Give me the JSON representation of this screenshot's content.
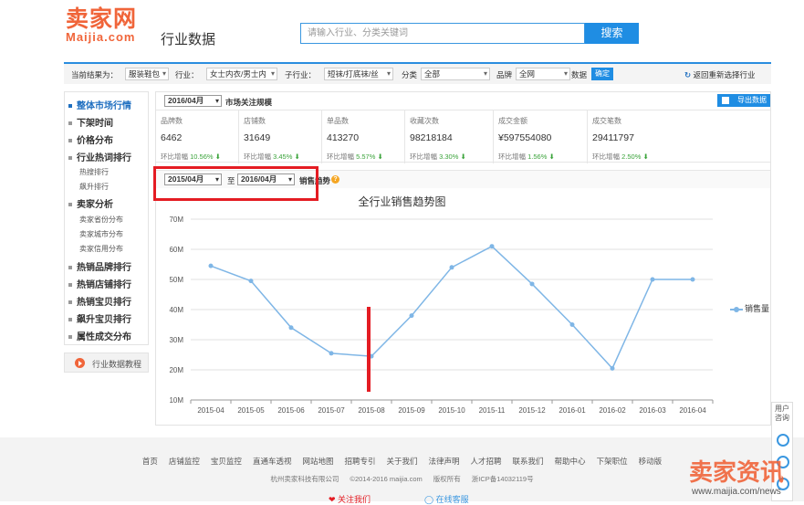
{
  "header": {
    "logo_cn": "卖家网",
    "logo_en": "Maijia.com",
    "section_title": "行业数据",
    "search_placeholder": "请输入行业、分类关键词",
    "search_button": "搜索"
  },
  "filter_bar": {
    "current_label": "当前结果为：",
    "fields": [
      {
        "label": "",
        "value": "服装鞋包"
      },
      {
        "label": "行业：",
        "value": "女士内衣/男士内"
      },
      {
        "label": "子行业：",
        "value": "短袜/打底袜/丝"
      },
      {
        "label": "分类",
        "value": "全部"
      },
      {
        "label": "品牌",
        "value": "全网"
      }
    ],
    "data_label": "数据",
    "confirm_button": "确定",
    "reselect_link": "返回重新选择行业"
  },
  "sidebar": {
    "items": [
      {
        "label": "整体市场行情",
        "active": true,
        "subs": []
      },
      {
        "label": "下架时间",
        "active": false,
        "subs": []
      },
      {
        "label": "价格分布",
        "active": false,
        "subs": []
      },
      {
        "label": "行业热词排行",
        "active": false,
        "subs": [
          "热搜排行",
          "飙升排行"
        ]
      },
      {
        "label": "卖家分析",
        "active": false,
        "subs": [
          "卖家省份分布",
          "卖家城市分布",
          "卖家信用分布"
        ]
      },
      {
        "label": "热销品牌排行",
        "active": false,
        "subs": []
      },
      {
        "label": "热销店铺排行",
        "active": false,
        "subs": []
      },
      {
        "label": "热销宝贝排行",
        "active": false,
        "subs": []
      },
      {
        "label": "飙升宝贝排行",
        "active": false,
        "subs": []
      },
      {
        "label": "属性成交分布",
        "active": false,
        "subs": []
      }
    ],
    "tutorial": "行业数据教程"
  },
  "overview": {
    "month": "2016/04月",
    "title": "市场关注规模",
    "export_button": "导出数据",
    "stats": [
      {
        "label": "品牌数",
        "value": "6462",
        "change_label": "环比增幅",
        "change": "10.56%"
      },
      {
        "label": "店铺数",
        "value": "31649",
        "change_label": "环比增幅",
        "change": "3.45%"
      },
      {
        "label": "单品数",
        "value": "413270",
        "change_label": "环比增幅",
        "change": "5.57%"
      },
      {
        "label": "收藏次数",
        "value": "98218184",
        "change_label": "环比增幅",
        "change": "3.30%"
      },
      {
        "label": "成交金额",
        "value": "¥597554080",
        "change_label": "环比增幅",
        "change": "1.56%"
      },
      {
        "label": "成交笔数",
        "value": "29411797",
        "change_label": "环比增幅",
        "change": "2.50%"
      }
    ]
  },
  "trend_controls": {
    "start_month": "2015/04月",
    "to": "至",
    "end_month": "2016/04月",
    "metric": "销售趋势",
    "help": "?"
  },
  "chart_data": {
    "type": "line",
    "title": "全行业销售趋势图",
    "x": [
      "2015-04",
      "2015-05",
      "2015-06",
      "2015-07",
      "2015-08",
      "2015-09",
      "2015-10",
      "2015-11",
      "2015-12",
      "2016-01",
      "2016-02",
      "2016-03",
      "2016-04"
    ],
    "series": [
      {
        "name": "销售量",
        "values": [
          54.5,
          49.5,
          34.0,
          25.5,
          24.5,
          38.0,
          54.0,
          61.0,
          48.5,
          35.0,
          20.5,
          50.0,
          50.0
        ]
      }
    ],
    "y_ticks": [
      "10M",
      "20M",
      "30M",
      "40M",
      "50M",
      "60M",
      "70M"
    ],
    "ylim": [
      10,
      70
    ],
    "y_unit": "M",
    "grid": true,
    "legend_position": "right",
    "color": "#7fb6e6"
  },
  "footer": {
    "nav": [
      "首页",
      "店铺监控",
      "宝贝监控",
      "直通车透视",
      "网站地图",
      "招聘专引",
      "关于我们",
      "法律声明",
      "人才招聘",
      "联系我们",
      "帮助中心",
      "下架职位",
      "移动版"
    ],
    "copyright": [
      "杭州卖家科技有限公司",
      "©2014-2016 maijia.com",
      "版权所有",
      "浙ICP备14032119号"
    ],
    "bottom_left": "❤ 关注我们",
    "bottom_right": "◯ 在线客服"
  },
  "service": {
    "label": "用户咨询"
  },
  "watermark": {
    "text": "卖家资讯",
    "url": "www.maijia.com/news"
  }
}
